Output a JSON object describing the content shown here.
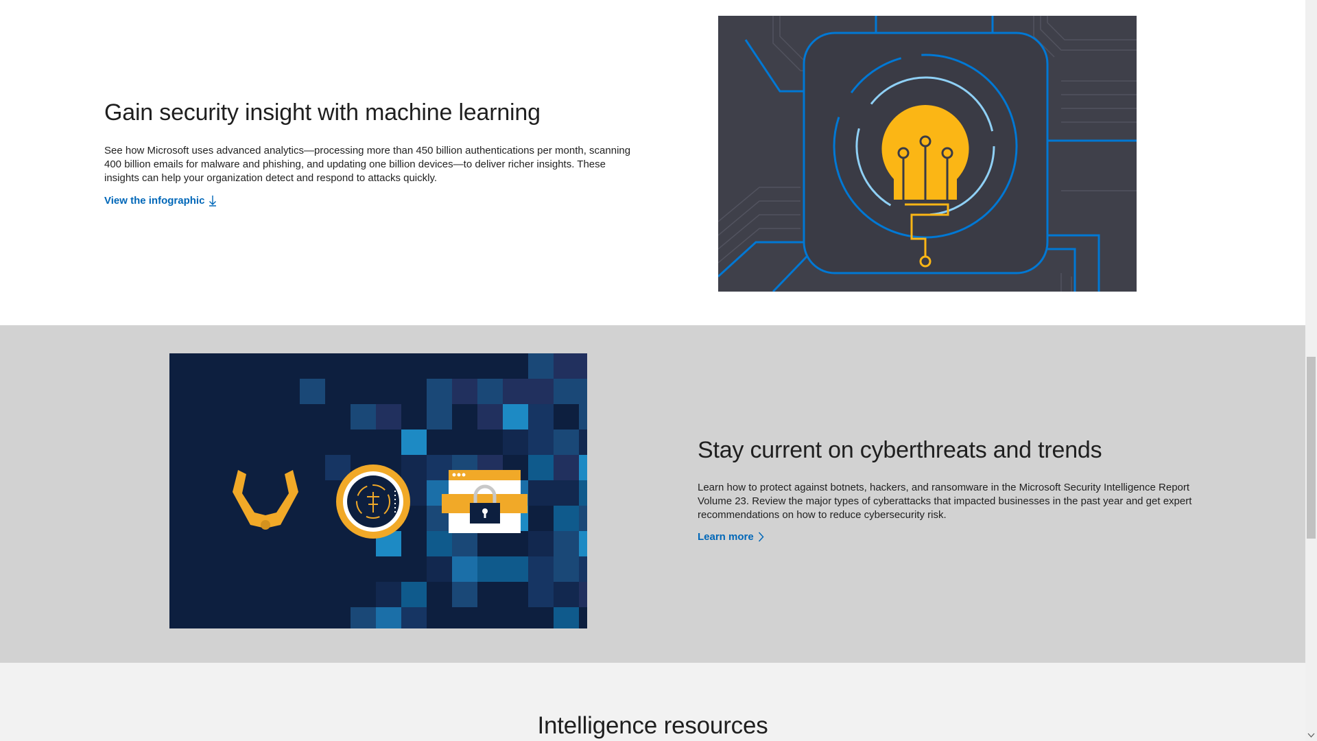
{
  "section1": {
    "title": "Gain security insight with machine learning",
    "body": "See how Microsoft uses advanced analytics—processing more than 450 billion authentications per month, scanning 400 billion emails for malware and phishing, and updating one billion devices—to deliver richer insights. These insights can help your organization detect and respond to attacks quickly.",
    "link_label": "View the infographic",
    "link_icon": "download-arrow-icon"
  },
  "section2": {
    "title": "Stay current on cyberthreats and trends",
    "body": "Learn how to protect against botnets, hackers, and ransomware in the Microsoft Security Intelligence Report Volume 23. Review the major types of cyberattacks that impacted businesses in the past year and get expert recommendations on how to reduce cybersecurity risk.",
    "link_label": "Learn more",
    "link_icon": "chevron-right-icon"
  },
  "section3": {
    "title": "Intelligence resources"
  },
  "colors": {
    "link": "#0067b8",
    "gray_band": "#d2d2d2",
    "light_band": "#f2f2f2",
    "navy": "#0d1f3f",
    "gold": "#fbb615",
    "circuit_blue": "#0078d4"
  }
}
